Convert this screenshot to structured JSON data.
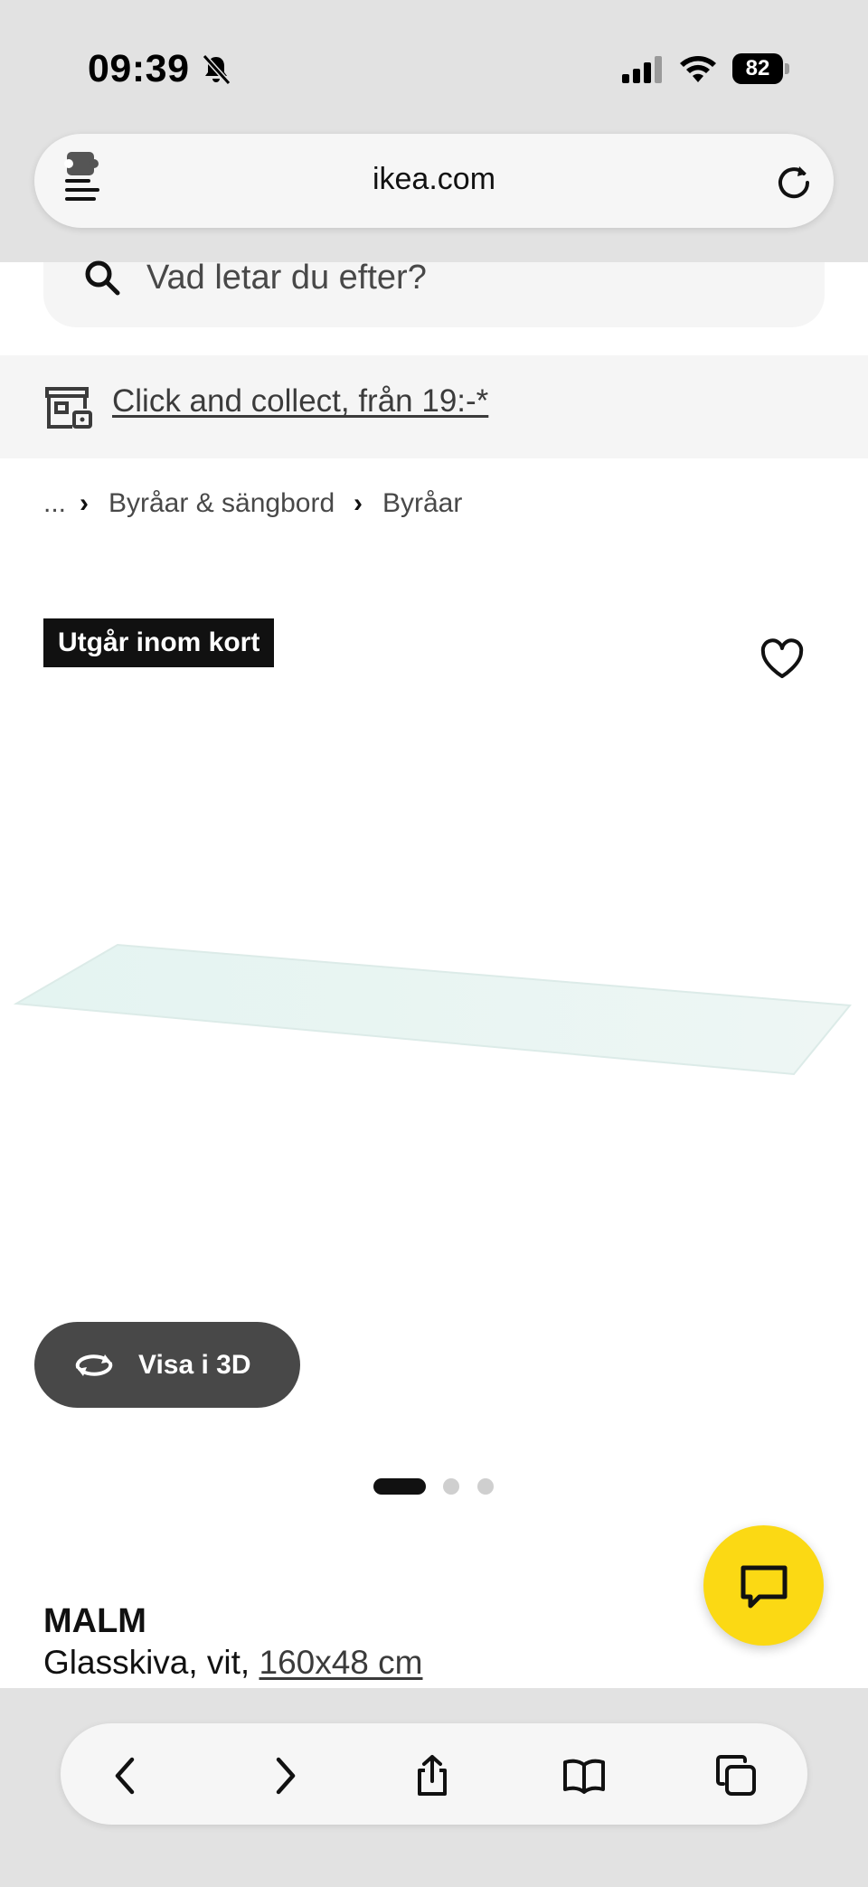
{
  "status_bar": {
    "time": "09:39",
    "battery": "82"
  },
  "browser": {
    "url": "ikea.com"
  },
  "search": {
    "placeholder": "Vad letar du efter?"
  },
  "collect": {
    "label": "Click and collect, från 19:-*"
  },
  "breadcrumb": {
    "ellipsis": "...",
    "separator": "›",
    "items": [
      "Byråar & sängbord",
      "Byråar"
    ]
  },
  "product": {
    "badge": "Utgår inom kort",
    "view_3d_label": "Visa i 3D",
    "carousel_total": 3,
    "carousel_active": 1,
    "brand": "MALM",
    "description_prefix": "Glasskiva, vit, ",
    "size": "160x48 cm"
  },
  "colors": {
    "accent_yellow": "#fbd914",
    "badge_bg": "#111111",
    "view3d_bg": "#484848"
  },
  "icons": {
    "bell": "bell-slash-icon",
    "search": "search-icon",
    "store": "store-icon",
    "heart": "heart-icon",
    "rotate": "rotate-3d-icon",
    "chat": "chat-icon",
    "back": "chevron-left-icon",
    "forward": "chevron-right-icon",
    "share": "share-icon",
    "bookmarks": "book-icon",
    "tabs": "tabs-icon"
  }
}
